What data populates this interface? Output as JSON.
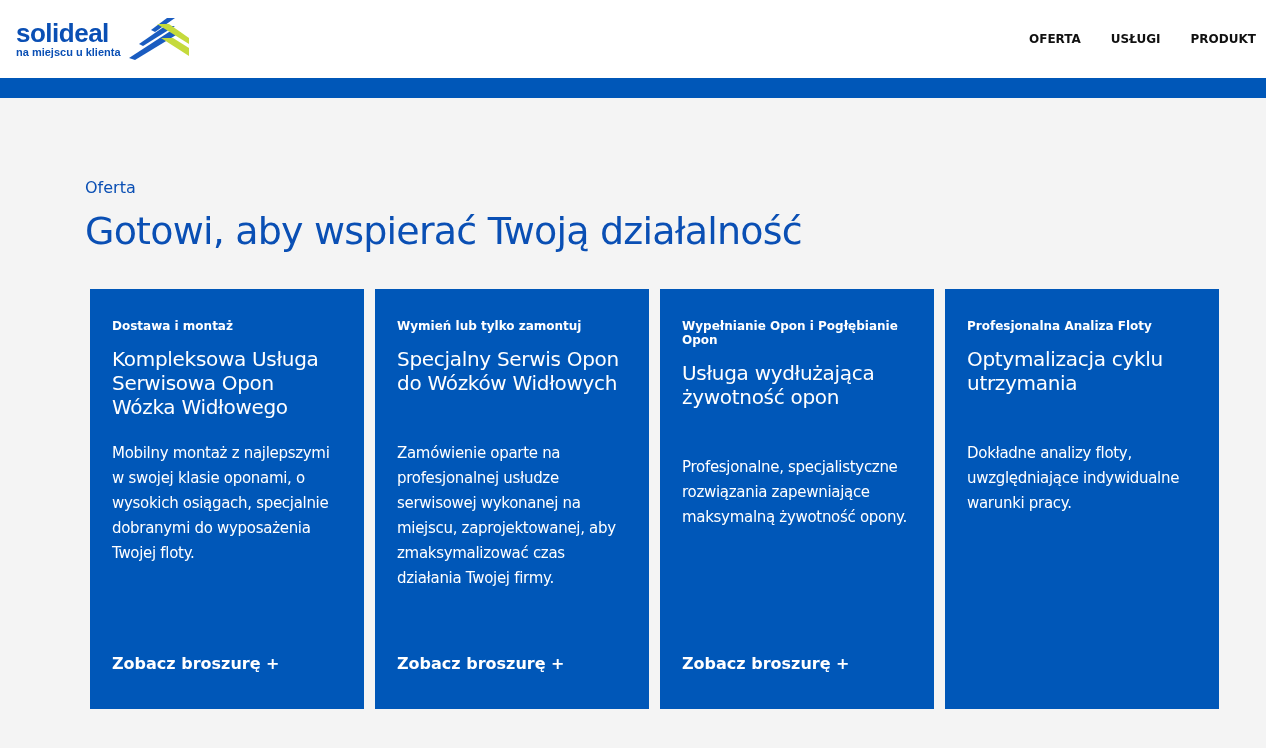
{
  "logo": {
    "name": "solideal",
    "tagline": "na miejscu u klienta"
  },
  "nav": [
    {
      "label": "OFERTA"
    },
    {
      "label": "USŁUGI"
    },
    {
      "label": "PRODUKT"
    }
  ],
  "section": {
    "eyebrow": "Oferta",
    "title": "Gotowi, aby wspierać Twoją działalność"
  },
  "cards": [
    {
      "category": "Dostawa i montaż",
      "title": "Kompleksowa Usługa Serwisowa Opon Wózka Widłowego",
      "description": "Mobilny montaż z najlepszymi w swojej klasie oponami, o wysokich osiągach, specjalnie dobranymi do wyposażenia Twojej floty.",
      "link": "Zobacz broszurę +"
    },
    {
      "category": "Wymień lub tylko zamontuj",
      "title": "Specjalny Serwis Opon do Wózków Widłowych",
      "description": "Zamówienie oparte na profesjonalnej usłudze serwisowej wykonanej na miejscu, zaprojektowanej, aby zmaksymalizować czas działania Twojej firmy.",
      "link": "Zobacz broszurę +"
    },
    {
      "category": "Wypełnianie Opon i Pogłębianie Opon",
      "title": "Usługa wydłużająca żywotność opon",
      "description": "Profesjonalne, specjalistyczne rozwiązania zapewniające maksymalną żywotność opony.",
      "link": "Zobacz broszurę +"
    },
    {
      "category": "Profesjonalna Analiza Floty",
      "title": "Optymalizacja cyklu utrzymania",
      "description": "Dokładne analizy floty, uwzględniające indywidualne warunki pracy."
    }
  ]
}
